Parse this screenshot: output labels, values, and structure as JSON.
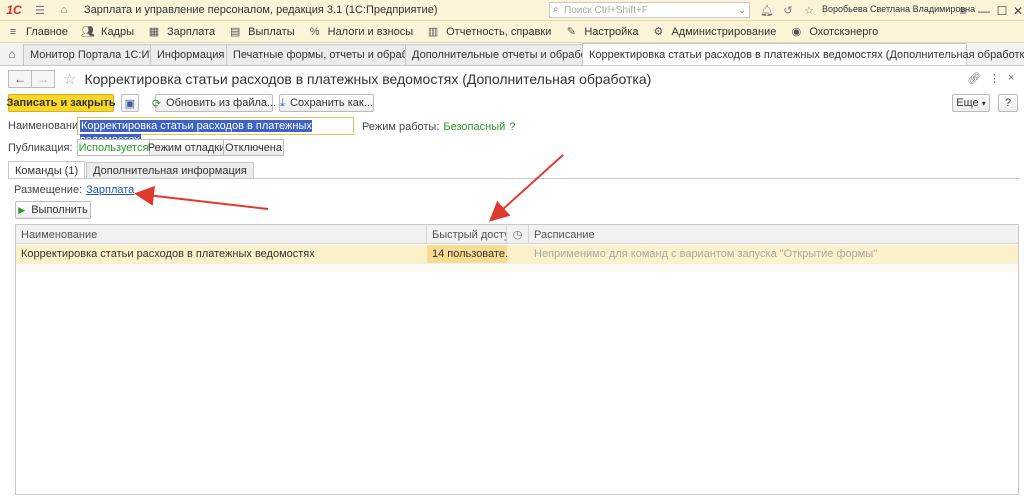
{
  "titlebar": {
    "logo": "1С",
    "app_title": "Зарплата и управление персоналом, редакция 3.1  (1С:Предприятие)",
    "search_placeholder": "Поиск Ctrl+Shift+F",
    "user": "Воробьева Светлана Владимировна"
  },
  "menu": {
    "items": [
      {
        "label": "Главное",
        "icon": "hamburger-icon"
      },
      {
        "label": "Кадры",
        "icon": "people-icon"
      },
      {
        "label": "Зарплата",
        "icon": "calculator-icon"
      },
      {
        "label": "Выплаты",
        "icon": "wallet-icon"
      },
      {
        "label": "Налоги и взносы",
        "icon": "percent-icon"
      },
      {
        "label": "Отчетность, справки",
        "icon": "report-icon"
      },
      {
        "label": "Настройка",
        "icon": "wrench-icon"
      },
      {
        "label": "Администрирование",
        "icon": "gear-icon"
      },
      {
        "label": "Охотскэнерго",
        "icon": "company-icon"
      }
    ]
  },
  "window_tabs": [
    {
      "label": "Монитор Портала 1С:ИТС"
    },
    {
      "label": "Информация"
    },
    {
      "label": "Печатные формы, отчеты и обработки"
    },
    {
      "label": "Дополнительные отчеты и обработки"
    },
    {
      "label": "Корректировка статьи расходов в платежных ведомостях (Дополнительная обработка)"
    }
  ],
  "form": {
    "title": "Корректировка статьи расходов в платежных ведомостях (Дополнительная обработка)",
    "buttons": {
      "save_close": "Записать и закрыть",
      "update_from_file": "Обновить из файла...",
      "save_as": "Сохранить как...",
      "more": "Еще",
      "help": "?"
    },
    "name_label": "Наименование:",
    "name_value": "Корректировка статьи расходов в платежных ведомостях",
    "mode_label": "Режим работы:",
    "mode_value": "Безопасный",
    "mode_help": "?",
    "publication_label": "Публикация:",
    "publication_options": [
      "Используется",
      "Режим отладки",
      "Отключена"
    ],
    "publication_selected": "Используется",
    "tabs": [
      "Команды (1)",
      "Дополнительная информация"
    ],
    "placement_label": "Размещение:",
    "placement_link": "Зарплата",
    "run_button": "Выполнить",
    "grid": {
      "headers": [
        "Наименование",
        "Быстрый доступ",
        "",
        "Расписание"
      ],
      "rows": [
        {
          "name": "Корректировка статьи расходов в платежных ведомостях",
          "quick_access": "14 пользовате...",
          "schedule": "Неприменимо для команд с вариантом запуска \"Открытие формы\""
        }
      ]
    }
  },
  "colors": {
    "panel_bg": "#fbf4d8",
    "primary_button": "#f8d62a",
    "selected_row": "#fdf1c9",
    "link": "#1a57b8",
    "accent_green": "#2a9a2a",
    "annotation_arrow": "#e03a2f"
  }
}
